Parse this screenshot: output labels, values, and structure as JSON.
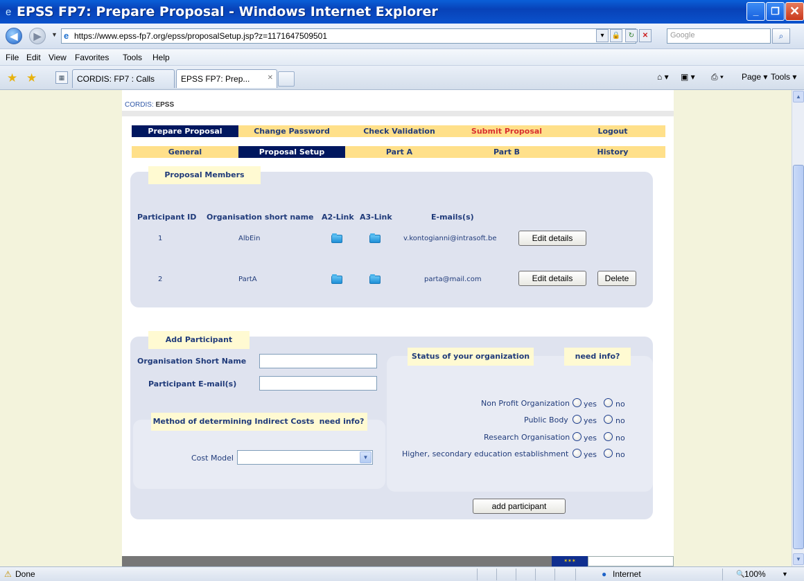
{
  "window": {
    "title": "EPSS FP7: Prepare Proposal - Windows Internet Explorer"
  },
  "address": {
    "url": "https://www.epss-fp7.org/epss/proposalSetup.jsp?z=1171647509501",
    "search_placeholder": "Google"
  },
  "menu": [
    "File",
    "Edit",
    "View",
    "Favorites",
    "Tools",
    "Help"
  ],
  "tabs": [
    {
      "label": "CORDIS: FP7 : Calls",
      "active": false
    },
    {
      "label": "EPSS FP7: Prep...",
      "active": true
    }
  ],
  "commands": {
    "page": "Page",
    "tools": "Tools"
  },
  "page": {
    "breadcrumb": {
      "prefix": "CORDIS:",
      "current": "EPSS"
    },
    "top_nav": [
      {
        "label": "Prepare Proposal",
        "selected": true,
        "red": false
      },
      {
        "label": "Change Password",
        "selected": false,
        "red": false
      },
      {
        "label": "Check Validation",
        "selected": false,
        "red": false
      },
      {
        "label": "Submit Proposal",
        "selected": false,
        "red": true
      },
      {
        "label": "Logout",
        "selected": false,
        "red": false
      }
    ],
    "sub_nav": [
      {
        "label": "General",
        "selected": false
      },
      {
        "label": "Proposal Setup",
        "selected": true
      },
      {
        "label": "Part A",
        "selected": false
      },
      {
        "label": "Part B",
        "selected": false
      },
      {
        "label": "History",
        "selected": false
      }
    ],
    "members": {
      "title": "Proposal Members",
      "columns": [
        "Participant ID",
        "Organisation short name",
        "A2-Link",
        "A3-Link",
        "E-mails(s)"
      ],
      "rows": [
        {
          "id": "1",
          "name": "AlbEin",
          "email": "v.kontogianni@intrasoft.be",
          "edit": "Edit details",
          "delete": ""
        },
        {
          "id": "2",
          "name": "PartA",
          "email": "parta@mail.com",
          "edit": "Edit details",
          "delete": "Delete"
        }
      ]
    },
    "add": {
      "title": "Add Participant",
      "org_short_name_label": "Organisation Short Name",
      "email_label": "Participant E-mail(s)",
      "indirect_costs_title": "Method of determining Indirect Costs",
      "need_info": "need info?",
      "cost_model_label": "Cost Model",
      "status_title": "Status of your organization",
      "statuses": [
        "Non Profit Organization",
        "Public Body",
        "Research Organisation",
        "Higher, secondary education establishment"
      ],
      "yes": "yes",
      "no": "no",
      "submit": "add participant"
    }
  },
  "status": {
    "left": "Done",
    "zone": "Internet",
    "zoom": "100%"
  }
}
